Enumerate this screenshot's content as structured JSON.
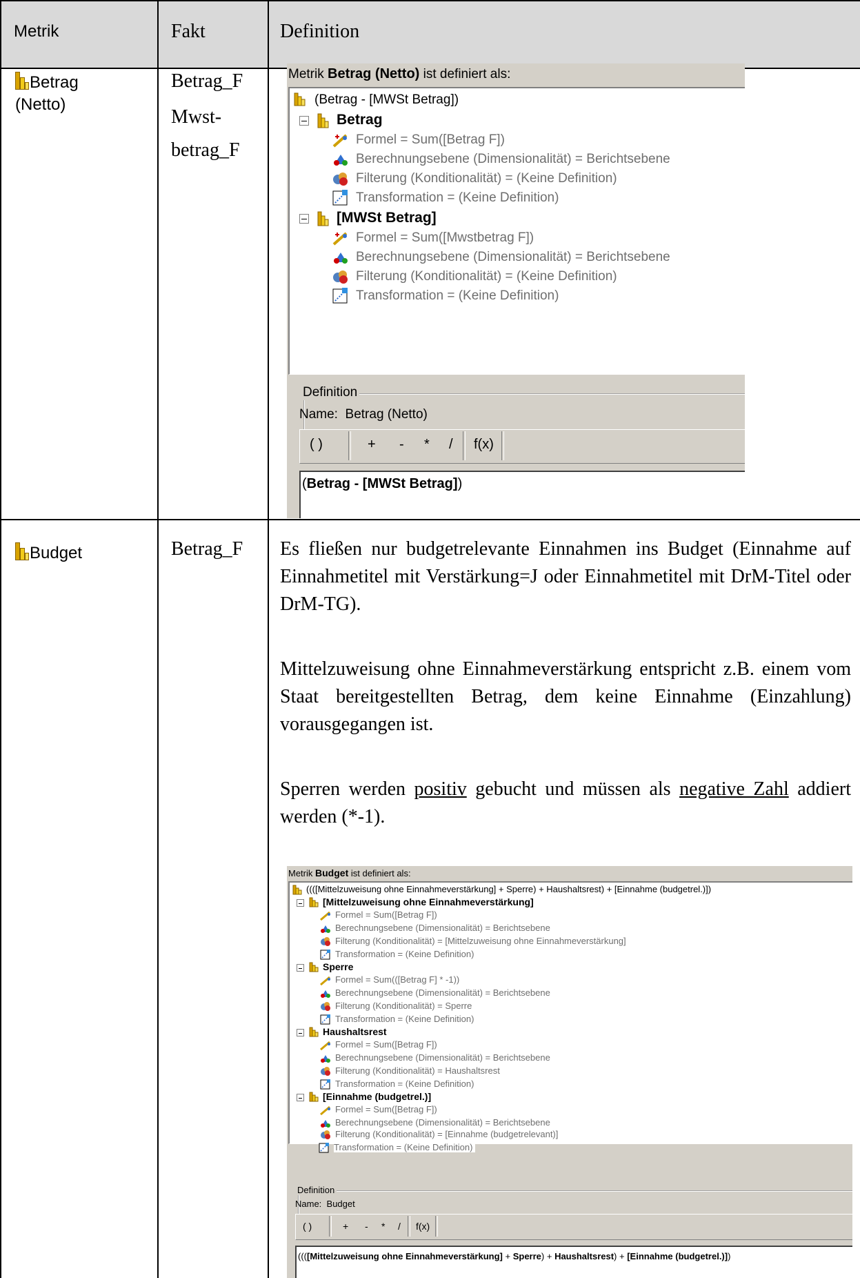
{
  "header": {
    "metrik": "Metrik",
    "fakt": "Fakt",
    "definition": "Definition"
  },
  "rows": [
    {
      "metric_line1": "Betrag",
      "metric_line2": "(Netto)",
      "facts": [
        "Betrag_F",
        "Mwst-",
        "betrag_F"
      ],
      "editor": {
        "title_prefix": "Metrik",
        "title_name": "Betrag (Netto)",
        "title_suffix": "ist definiert als:",
        "root": "(Betrag - [MWSt Betrag])",
        "items": [
          {
            "name": "Betrag",
            "props": [
              "Formel = Sum([Betrag F])",
              "Berechnungsebene (Dimensionalität) = Berichtsebene",
              "Filterung (Konditionalität) = (Keine Definition)",
              "Transformation = (Keine Definition)"
            ]
          },
          {
            "name": "[MWSt Betrag]",
            "props": [
              "Formel = Sum([Mwstbetrag F])",
              "Berechnungsebene (Dimensionalität) = Berichtsebene",
              "Filterung (Konditionalität) = (Keine Definition)",
              "Transformation = (Keine Definition)"
            ]
          }
        ],
        "definition_legend": "Definition",
        "name_label": "Name:",
        "name_value": "Betrag (Netto)",
        "toolbar": [
          "( )",
          "+",
          "-",
          "*",
          "/",
          "f(x)"
        ],
        "formula_parts": [
          "(",
          "Betrag - [MWSt Betrag]",
          ")"
        ]
      }
    },
    {
      "metric_line1": "Budget",
      "facts": [
        "Betrag_F"
      ],
      "paragraphs": {
        "p1": "Es fließen nur budgetrelevante Einnahmen ins Budget (Einnahme auf Einnahmetitel mit Verstärkung=J oder Einnahmetitel mit DrM-Titel oder DrM-TG).",
        "p2": "Mittelzuweisung ohne Einnahmeverstärkung entspricht z.B. einem vom Staat bereitgestellten Betrag, dem keine Einnahme (Einzahlung) vorausgegangen ist.",
        "p3_a": "Sperren werden ",
        "p3_u1": "positiv",
        "p3_b": " gebucht und müssen als ",
        "p3_u2": "negative Zahl",
        "p3_c": " addiert werden (*-1)."
      },
      "editor": {
        "title_prefix": "Metrik",
        "title_name": "Budget",
        "title_suffix": "ist definiert als:",
        "root": "((([Mittelzuweisung ohne Einnahmeverstärkung] + Sperre) + Haushaltsrest) + [Einnahme (budgetrel.)])",
        "items": [
          {
            "name": "[Mittelzuweisung ohne Einnahmeverstärkung]",
            "props": [
              "Formel = Sum([Betrag F])",
              "Berechnungsebene (Dimensionalität) = Berichtsebene",
              "Filterung (Konditionalität) = [Mittelzuweisung ohne Einnahmeverstärkung]",
              "Transformation = (Keine Definition)"
            ]
          },
          {
            "name": "Sperre",
            "props": [
              "Formel = Sum(([Betrag F] * -1))",
              "Berechnungsebene (Dimensionalität) = Berichtsebene",
              "Filterung (Konditionalität) = Sperre",
              "Transformation = (Keine Definition)"
            ]
          },
          {
            "name": "Haushaltsrest",
            "props": [
              "Formel = Sum([Betrag F])",
              "Berechnungsebene (Dimensionalität) = Berichtsebene",
              "Filterung (Konditionalität) = Haushaltsrest",
              "Transformation = (Keine Definition)"
            ]
          },
          {
            "name": "[Einnahme (budgetrel.)]",
            "props": [
              "Formel = Sum([Betrag F])",
              "Berechnungsebene (Dimensionalität) = Berichtsebene",
              "Filterung (Konditionalität) = [Einnahme (budgetrelevant)]",
              "Transformation = (Keine Definition)"
            ]
          }
        ],
        "definition_legend": "Definition",
        "name_label": "Name:",
        "name_value": "Budget",
        "toolbar": [
          "( )",
          "+",
          "-",
          "*",
          "/",
          "f(x)"
        ],
        "formula_parts": [
          "(((",
          "[Mittelzuweisung ohne Einnahmeverstärkung]",
          " + ",
          "Sperre",
          ") + ",
          "Haushaltsrest",
          ") + ",
          "[Einnahme (budgetrel.)]",
          ")"
        ]
      }
    }
  ],
  "colors": {
    "header_bg": "#d9d9d9",
    "editor_bg": "#d4d0c8",
    "prop_text": "#6e6e6e"
  }
}
